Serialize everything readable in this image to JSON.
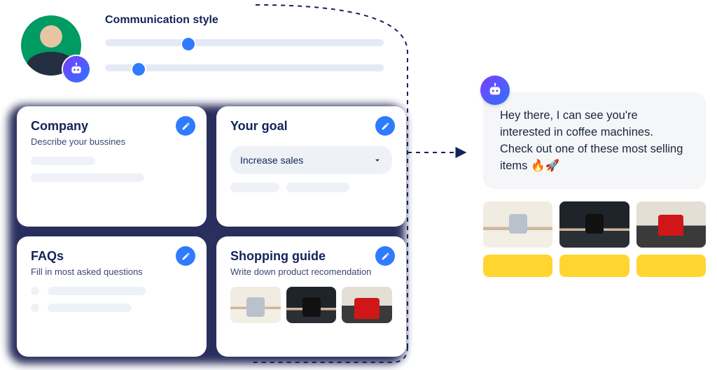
{
  "header": {
    "title": "Communication style",
    "sliders": [
      {
        "pos": 30
      },
      {
        "pos": 12
      }
    ]
  },
  "cards": {
    "company": {
      "title": "Company",
      "subtitle": "Describe your bussines"
    },
    "goal": {
      "title": "Your goal",
      "select_label": "Increase sales"
    },
    "faqs": {
      "title": "FAQs",
      "subtitle": "Fill in most asked questions"
    },
    "shopping": {
      "title": "Shopping guide",
      "subtitle": "Write down product recomendation"
    }
  },
  "chat": {
    "message": "Hey there, I can see you're interested in coffee machines. Check out one of these most selling items 🔥🚀"
  }
}
